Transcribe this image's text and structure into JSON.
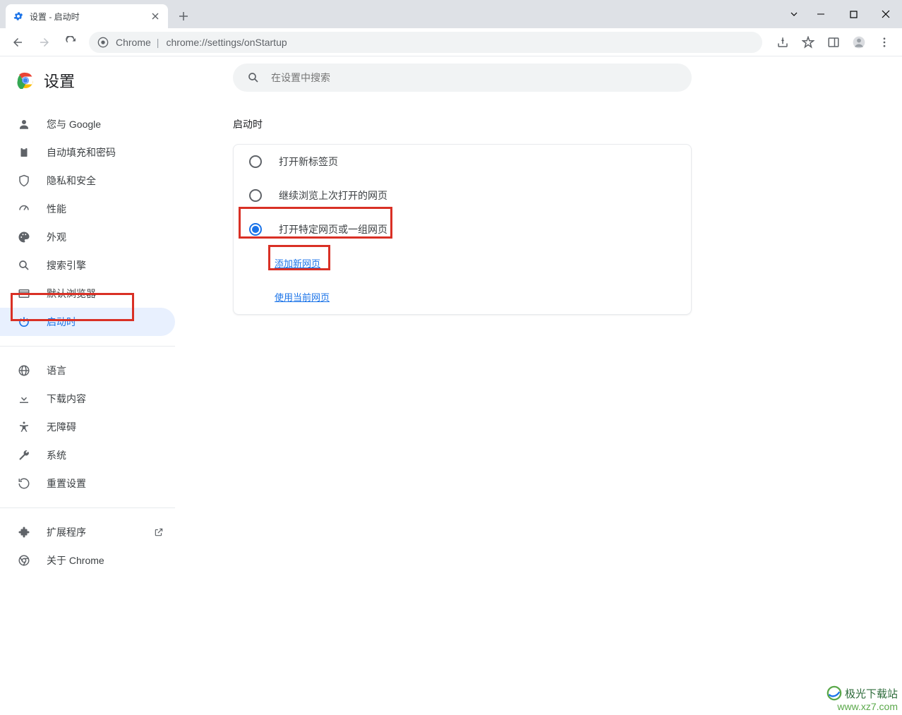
{
  "window": {
    "tab_title": "设置 - 启动时"
  },
  "toolbar": {
    "url_prefix": "Chrome",
    "url_path": "chrome://settings/onStartup"
  },
  "sidebar": {
    "title": "设置",
    "items": [
      {
        "label": "您与 Google"
      },
      {
        "label": "自动填充和密码"
      },
      {
        "label": "隐私和安全"
      },
      {
        "label": "性能"
      },
      {
        "label": "外观"
      },
      {
        "label": "搜索引擎"
      },
      {
        "label": "默认浏览器"
      },
      {
        "label": "启动时"
      }
    ],
    "items2": [
      {
        "label": "语言"
      },
      {
        "label": "下载内容"
      },
      {
        "label": "无障碍"
      },
      {
        "label": "系统"
      },
      {
        "label": "重置设置"
      }
    ],
    "items3": [
      {
        "label": "扩展程序"
      },
      {
        "label": "关于 Chrome"
      }
    ]
  },
  "search": {
    "placeholder": "在设置中搜索"
  },
  "section": {
    "title": "启动时",
    "options": [
      {
        "label": "打开新标签页"
      },
      {
        "label": "继续浏览上次打开的网页"
      },
      {
        "label": "打开特定网页或一组网页"
      }
    ],
    "links": {
      "add_page": "添加新网页",
      "use_current": "使用当前网页"
    }
  },
  "watermark": {
    "name": "极光下载站",
    "url": "www.xz7.com"
  }
}
